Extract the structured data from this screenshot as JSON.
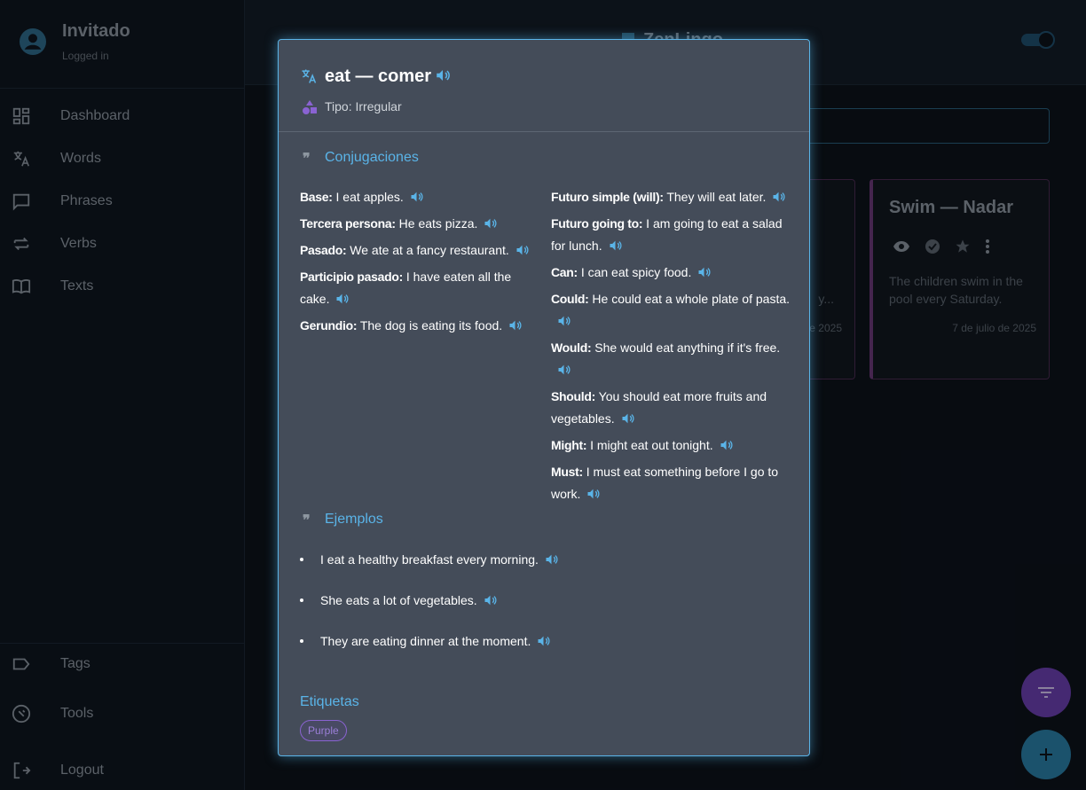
{
  "user": {
    "name": "Invitado",
    "status": "Logged in"
  },
  "nav": [
    {
      "label": "Dashboard",
      "icon": "dashboard-icon"
    },
    {
      "label": "Words",
      "icon": "translate-icon"
    },
    {
      "label": "Phrases",
      "icon": "chat-icon"
    },
    {
      "label": "Verbs",
      "icon": "repeat-icon"
    },
    {
      "label": "Texts",
      "icon": "book-icon"
    }
  ],
  "bottom_nav": [
    {
      "label": "Tags",
      "icon": "tag-icon"
    },
    {
      "label": "Tools",
      "icon": "wrench-icon"
    },
    {
      "label": "Logout",
      "icon": "logout-icon"
    }
  ],
  "header": {
    "brand": "ZenLingo"
  },
  "cards": [
    {
      "text": "y...",
      "date": "e 2025"
    },
    {
      "title": "Swim — Nadar",
      "text": "The children swim in the pool every Saturday.",
      "date": "7 de julio de 2025"
    }
  ],
  "modal": {
    "title": "eat — comer",
    "type": "Tipo: Irregular",
    "conjugations_title": "Conjugaciones",
    "conjugations_left": [
      {
        "label": "Base:",
        "text": "I eat apples."
      },
      {
        "label": "Tercera persona:",
        "text": "He eats pizza."
      },
      {
        "label": "Pasado:",
        "text": "We ate at a fancy restaurant."
      },
      {
        "label": "Participio pasado:",
        "text": "I have eaten all the cake."
      },
      {
        "label": "Gerundio:",
        "text": "The dog is eating its food."
      }
    ],
    "conjugations_right": [
      {
        "label": "Futuro simple (will):",
        "text": "They will eat later."
      },
      {
        "label": "Futuro going to:",
        "text": "I am going to eat a salad for lunch."
      },
      {
        "label": "Can:",
        "text": "I can eat spicy food."
      },
      {
        "label": "Could:",
        "text": "He could eat a whole plate of pasta."
      },
      {
        "label": "Would:",
        "text": "She would eat anything if it's free."
      },
      {
        "label": "Should:",
        "text": "You should eat more fruits and vegetables."
      },
      {
        "label": "Might:",
        "text": "I might eat out tonight."
      },
      {
        "label": "Must:",
        "text": "I must eat something before I go to work."
      }
    ],
    "examples_title": "Ejemplos",
    "examples": [
      "I eat a healthy breakfast every morning.",
      "She eats a lot of vegetables.",
      "They are eating dinner at the moment."
    ],
    "tags_title": "Etiquetas",
    "tags": [
      "Purple"
    ]
  },
  "colors": {
    "accent": "#5ab4e8",
    "purple": "#6a3fb0",
    "modal_bg": "#444c59"
  }
}
